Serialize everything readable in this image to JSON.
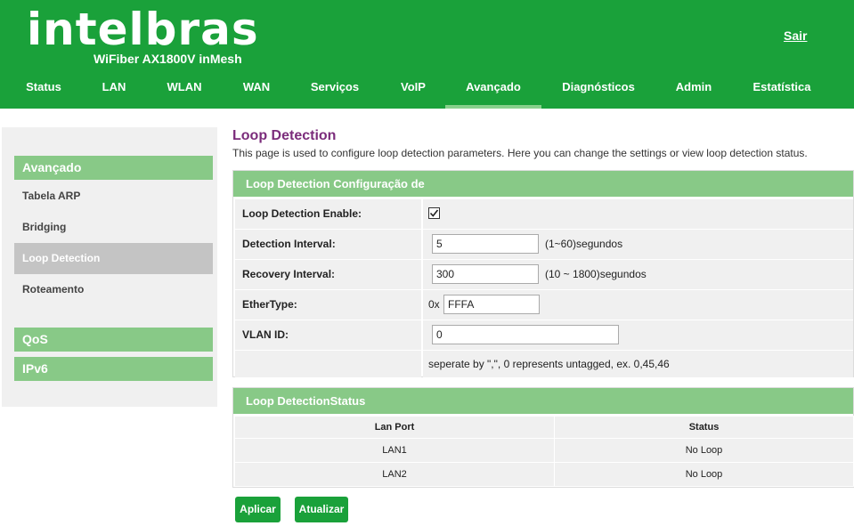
{
  "brand": {
    "logo_text": "intelbras",
    "model": "WiFiber AX1800V inMesh",
    "logout_label": "Sair"
  },
  "nav": {
    "items": [
      {
        "label": "Status"
      },
      {
        "label": "LAN"
      },
      {
        "label": "WLAN"
      },
      {
        "label": "WAN"
      },
      {
        "label": "Serviços"
      },
      {
        "label": "VoIP"
      },
      {
        "label": "Avançado"
      },
      {
        "label": "Diagnósticos"
      },
      {
        "label": "Admin"
      },
      {
        "label": "Estatística"
      }
    ],
    "active": "Avançado"
  },
  "sidebar": {
    "section_advanced": "Avançado",
    "items": [
      {
        "label": "Tabela ARP"
      },
      {
        "label": "Bridging"
      },
      {
        "label": "Loop Detection"
      },
      {
        "label": "Roteamento"
      }
    ],
    "active": "Loop Detection",
    "section_qos": "QoS",
    "section_ipv6": "IPv6"
  },
  "page": {
    "title": "Loop Detection",
    "description": "This page is used to configure loop detection parameters. Here you can change the settings or view loop detection status."
  },
  "config": {
    "header": "Loop Detection Configuração de",
    "enable_label": "Loop Detection Enable:",
    "enable_checked": true,
    "interval_label": "Detection Interval:",
    "interval_value": "5",
    "interval_hint": "(1~60)segundos",
    "recovery_label": "Recovery Interval:",
    "recovery_value": "300",
    "recovery_hint": "(10 ~ 1800)segundos",
    "ethertype_label": "EtherType:",
    "ethertype_prefix": "0x",
    "ethertype_value": "FFFA",
    "vlan_label": "VLAN ID:",
    "vlan_value": "0",
    "vlan_hint": "seperate by \",\", 0 represents untagged, ex. 0,45,46"
  },
  "status": {
    "header": "Loop DetectionStatus",
    "columns": [
      "Lan Port",
      "Status"
    ],
    "rows": [
      {
        "port": "LAN1",
        "status": "No Loop"
      },
      {
        "port": "LAN2",
        "status": "No Loop"
      }
    ]
  },
  "buttons": {
    "apply": "Aplicar",
    "refresh": "Atualizar"
  },
  "colors": {
    "brand_green": "#1aa13a",
    "panel_green": "#88c987",
    "title_purple": "#7b2c7b"
  }
}
